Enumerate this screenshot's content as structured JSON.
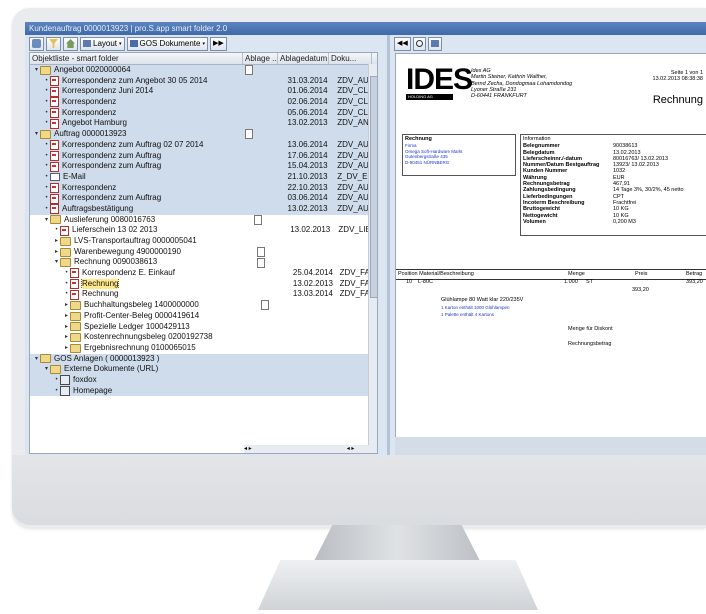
{
  "window": {
    "title": "Kundenauftrag 0000013923 | pro.S.app smart folder 2.0"
  },
  "left_toolbar": {
    "layout_label": "Layout",
    "gos_label": "GOS Dokumente"
  },
  "tree": {
    "headers": [
      "Objektliste - smart folder",
      "Ablage ...",
      "Ablagedatum",
      "Doku..."
    ],
    "rows": [
      {
        "label": "Angebot 0020000064",
        "date": "",
        "doc": "",
        "ablage": true
      },
      {
        "label": "Korrespondenz zum Angebot 30 05 2014",
        "date": "31.03.2014",
        "doc": "ZDV_AU..."
      },
      {
        "label": "Korrespondenz Juni 2014",
        "date": "01.06.2014",
        "doc": "ZDV_CL..."
      },
      {
        "label": "Korrespondenz",
        "date": "02.06.2014",
        "doc": "ZDV_CL..."
      },
      {
        "label": "Korrespondenz",
        "date": "05.06.2014",
        "doc": "ZDV_CL..."
      },
      {
        "label": "Angebot Hamburg",
        "date": "13.02.2013",
        "doc": "ZDV_ANG"
      },
      {
        "label": "Auftrag 0000013923",
        "date": "",
        "doc": "",
        "ablage": true
      },
      {
        "label": "Korrespondenz zum Auftrag 02 07 2014",
        "date": "13.06.2014",
        "doc": "ZDV_AU..."
      },
      {
        "label": "Korrespondenz zum Auftrag",
        "date": "17.06.2014",
        "doc": "ZDV_AU..."
      },
      {
        "label": "Korrespondenz zum Auftrag",
        "date": "15.04.2013",
        "doc": "ZDV_AU..."
      },
      {
        "label": "E-Mail",
        "date": "21.10.2013",
        "doc": "Z_DV_E..."
      },
      {
        "label": "Korrespondenz",
        "date": "22.10.2013",
        "doc": "ZDV_AU..."
      },
      {
        "label": "Korrespondenz zum Auftrag",
        "date": "03.06.2014",
        "doc": "ZDV_AU..."
      },
      {
        "label": "Auftragsbestätigung",
        "date": "13.02.2013",
        "doc": "ZDV_AU"
      },
      {
        "label": "Auslieferung 0080016763",
        "date": "",
        "doc": "",
        "ablage": true
      },
      {
        "label": "Lieferschein 13 02 2013",
        "date": "13.02.2013",
        "doc": "ZDV_LIEF"
      },
      {
        "label": "LVS-Transportauftrag 0000005041",
        "date": "",
        "doc": ""
      },
      {
        "label": "Warenbewegung 4900000190",
        "date": "",
        "doc": "",
        "ablage": true
      },
      {
        "label": "Rechnung 0090038613",
        "date": "",
        "doc": "",
        "ablage": true
      },
      {
        "label": "Korrespondenz E. Einkauf",
        "date": "25.04.2014",
        "doc": "ZDV_FAK"
      },
      {
        "label": "Rechnung",
        "date": "13.02.2013",
        "doc": "ZDV_FAK"
      },
      {
        "label": "Rechnung",
        "date": "13.03.2014",
        "doc": "ZDV_FAK"
      },
      {
        "label": "Buchhaltungsbeleg 1400000000",
        "date": "",
        "doc": "",
        "ablage": true
      },
      {
        "label": "Profit-Center-Beleg 0000419614",
        "date": "",
        "doc": ""
      },
      {
        "label": "Spezielle Ledger 1000429113",
        "date": "",
        "doc": ""
      },
      {
        "label": "Kostenrechnungsbeleg 0200192738",
        "date": "",
        "doc": ""
      },
      {
        "label": "Ergebnisrechnung 0100065015",
        "date": "",
        "doc": ""
      },
      {
        "label": "GOS Anlagen ( 0000013923 )",
        "date": "",
        "doc": ""
      },
      {
        "label": "Externe Dokumente (URL)",
        "date": "",
        "doc": ""
      },
      {
        "label": "foxdox",
        "date": "",
        "doc": ""
      },
      {
        "label": "Homepage",
        "date": "",
        "doc": ""
      }
    ]
  },
  "invoice": {
    "logo": "IDES",
    "logo_sub": "HOLDING AG",
    "sender": [
      "Ides AG",
      "Martin Steiner, Kathrin Walther,",
      "Bernd Zecha, Dondogmaa Lohamdondog",
      "Lyoner Straße 231",
      "D-60441 FRANKFURT"
    ],
    "page_info": "Seite 1 von 1",
    "page_date": "13.02.2013 08:38:38",
    "heading": "Rechnung",
    "recipient_title": "Rechnung",
    "recipient": [
      "Firma",
      "Omega Soft-Hardware Markt",
      "Gutenbergstraße 435",
      "D-90451 NÜRNBERG"
    ],
    "info_title": "Information",
    "info_labels": [
      "Belegnummer",
      "Belegdatum",
      "Lieferscheinnr./-datum",
      "Nummer/Datum Bestgauftrag",
      "Kunden Nummer",
      "Währung",
      "Rechnungsbetrag",
      "Zahlungsbedingung",
      "Lieferbedingungen",
      "Incoterm Beschreibung",
      "Bruttogewicht",
      "Nettogewicht",
      "Volumen"
    ],
    "info_values": [
      "90038613",
      "13.02.2013",
      "80016763/ 13.02.2013",
      "13923/ 13.02.2013",
      "1032",
      "EUR",
      "467,91",
      "14 Tage 3%, 30/2%, 45 netto",
      "CPT",
      "Frachtfrei",
      "10 KG",
      "10 KG",
      "0,200 M3"
    ],
    "table_headers": [
      "Position Material/Beschreibung",
      "Menge",
      "Preis",
      "Betrag"
    ],
    "line_pos": "10",
    "line_material": "L-80C",
    "line_qty": "1.000",
    "line_unit": "ST",
    "line_price": "393,20",
    "line_amount": "393,20",
    "line_desc": "Glühlampe 80 Watt klar 220/235V",
    "line_note1": "1 Karton enthält 1000 Glühlampen",
    "line_note2": "1 Palette enthält 4 Kartons",
    "discount_label": "Menge für Diskont",
    "total_label": "Rechnungsbetrag"
  },
  "colors": {
    "title_bar": "#3f69a8",
    "pane_bg": "#dce6f2",
    "selection": "#ffe98a",
    "pdf_red": "#c83232"
  }
}
